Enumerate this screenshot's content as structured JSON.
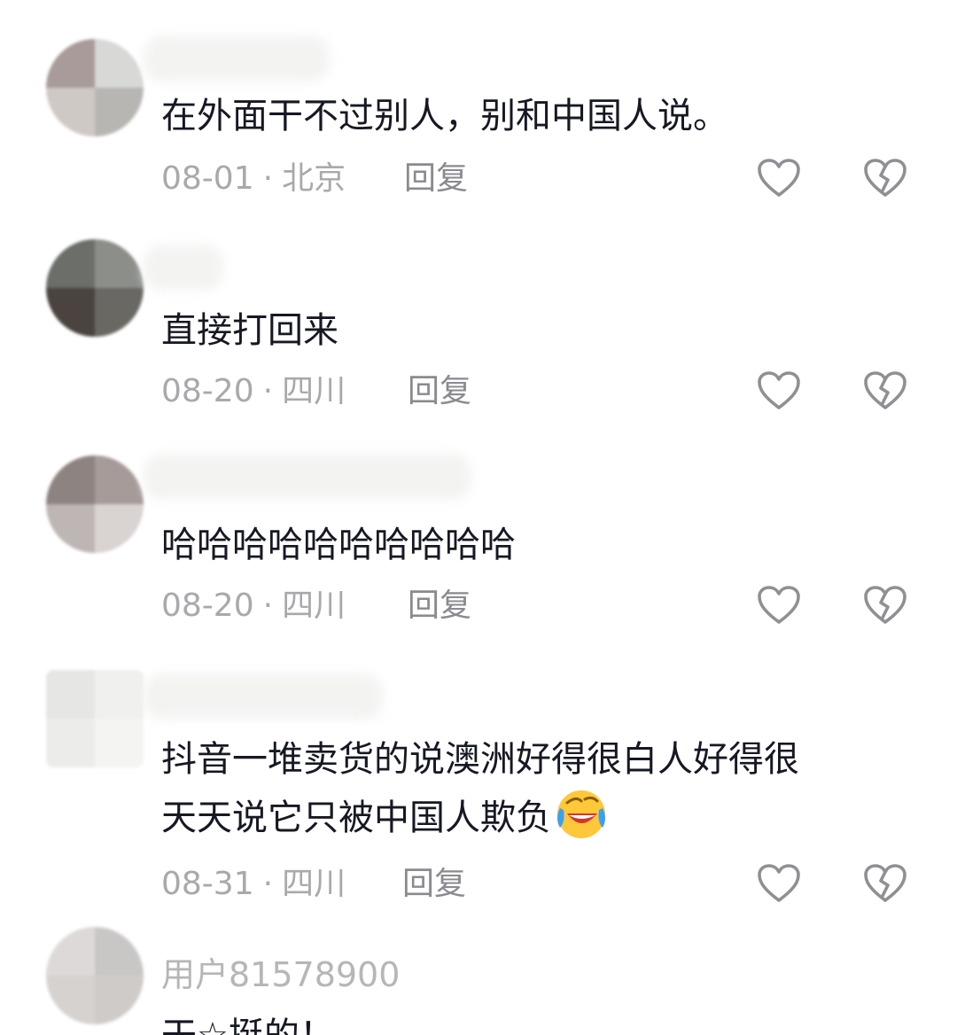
{
  "comments": [
    {
      "name": "",
      "text_lines": [
        "在外面干不过别人，别和中国人说。"
      ],
      "date": "08-01",
      "location": "北京",
      "reply_label": "回复"
    },
    {
      "name": "",
      "text_lines": [
        "直接打回来"
      ],
      "date": "08-20",
      "location": "四川",
      "reply_label": "回复"
    },
    {
      "name": "",
      "text_lines": [
        "哈哈哈哈哈哈哈哈哈哈"
      ],
      "date": "08-20",
      "location": "四川",
      "reply_label": "回复"
    },
    {
      "name": "",
      "text_lines": [
        "抖音一堆卖货的说澳洲好得很白人好得很",
        "天天说它只被中国人欺负"
      ],
      "date": "08-31",
      "location": "四川",
      "reply_label": "回复"
    },
    {
      "name": "用户81578900",
      "text_lines": [
        "干☆挺的！"
      ]
    }
  ],
  "meta_separator": "·",
  "icons": {
    "like": "heart-outline-icon",
    "dislike": "broken-heart-outline-icon",
    "emoji": "crying-laughing-emoji-icon"
  },
  "colors": {
    "text": "#161823",
    "meta": "#a9a9ad",
    "reply": "#8a8a8f",
    "icon": "#909094"
  }
}
